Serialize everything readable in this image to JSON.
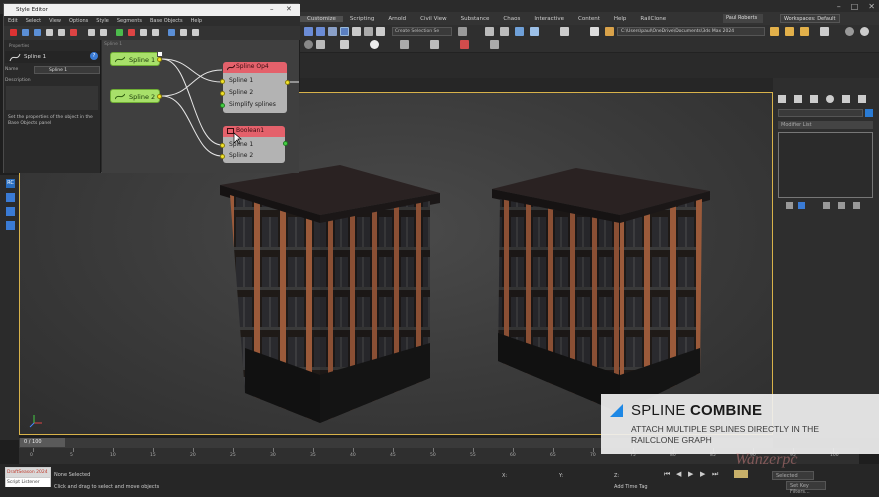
{
  "max_menu": {
    "items": [
      "Customize",
      "Scripting",
      "Arnold",
      "Civil View",
      "Substance",
      "Chaos",
      "Interactive",
      "Content",
      "Help",
      "RailClone"
    ],
    "active_index": 0,
    "user": "Paul Roberts",
    "workspace": "Workspaces: Default"
  },
  "max_toolbar": {
    "create_selection": "Create Selection Se",
    "project_path": "C:\\Users\\paul\\OneDrive\\Documents\\3ds Max 2024"
  },
  "slate": {
    "title": "Style Editor",
    "menu": [
      "Edit",
      "Select",
      "View",
      "Options",
      "Style",
      "Segments",
      "Base Objects",
      "Help"
    ],
    "panel_header": "Properties",
    "object_name": "Spline 1",
    "row2_label": "Name",
    "row2_value": "Spline 1",
    "row3_label": "Description",
    "note": "Set the properties of the object in the Base Objects panel",
    "graph_tab": "Spline 1",
    "node_spline1": "Spline 1",
    "node_spline2": "Spline 2",
    "node_op": {
      "title": "Spline Op4",
      "ports": [
        "Spline 1",
        "Spline 2",
        "Simplify splines"
      ]
    },
    "node_boolean": {
      "title": "Boolean1",
      "ports": [
        "Spline 1",
        "Spline 2"
      ]
    }
  },
  "cmd_panel": {
    "sub_label": "Modifier List"
  },
  "timeline": {
    "frame": "0 / 100",
    "ticks": [
      "0",
      "5",
      "10",
      "15",
      "20",
      "25",
      "30",
      "35",
      "40",
      "45",
      "50",
      "55",
      "60",
      "65",
      "70",
      "75",
      "80",
      "85",
      "90",
      "95",
      "100"
    ]
  },
  "status": {
    "maxscript_a": "DraftSeason 2024",
    "maxscript_b": "Script Listener",
    "selection": "None Selected",
    "hint": "Click and drag to select and move objects",
    "x": "X:",
    "y": "Y:",
    "z": "Z:",
    "addtime": "Add Time Tag",
    "selected": "Selected",
    "filters": "Set Key Filters..."
  },
  "caption": {
    "title_light": "SPLINE ",
    "title_bold": "COMBINE",
    "subtitle": "ATTACH MULTIPLE SPLINES DIRECTLY IN THE RAILCLONE GRAPH"
  },
  "watermark": "Wanzerpc",
  "colors": {
    "accent_blue": "#1e88e5",
    "node_green": "#a8e06a",
    "node_red": "#e4616b",
    "selection_yellow": "#d8b24a"
  }
}
